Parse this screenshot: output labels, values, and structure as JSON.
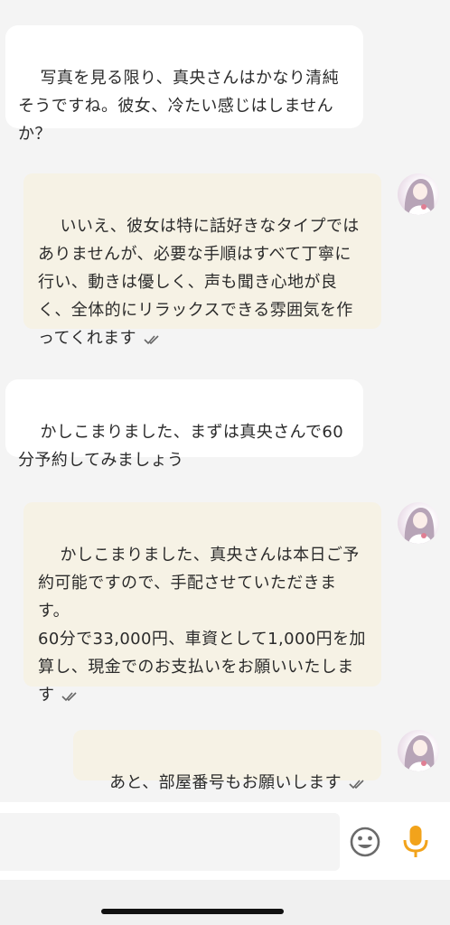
{
  "messages": [
    {
      "text": "写真を見る限り、真央さんはかなり清純そうですね。彼女、冷たい感じはしませんか？"
    },
    {
      "text": "いいえ、彼女は特に話好きなタイプではありませんが、必要な手順はすべて丁寧に行い、動きは優しく、声も聞き心地が良く、全体的にリラックスできる雰囲気を作ってくれます"
    },
    {
      "text": "かしこまりました、まずは真央さんで60分予約してみましょう"
    },
    {
      "text": "かしこまりました、真央さんは本日ご予約可能ですので、手配させていただきます。\n60分で33,000円、車資として1,000円を加算し、現金でのお支払いをお願いいたします"
    },
    {
      "text": "あと、部屋番号もお願いします"
    }
  ],
  "input": {
    "placeholder": ""
  },
  "icons": {
    "emoji": "smiley-icon",
    "mic": "microphone-icon",
    "read": "double-check-icon"
  },
  "colors": {
    "out_bubble": "#f6f2e5",
    "in_bubble": "#ffffff",
    "mic": "#f2a31b"
  }
}
